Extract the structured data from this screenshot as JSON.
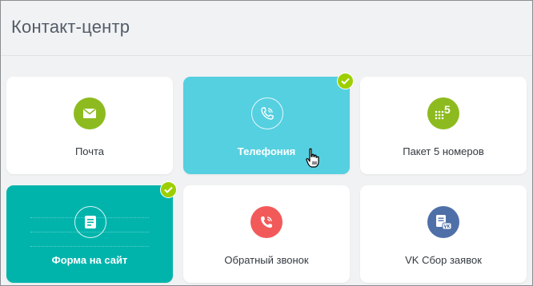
{
  "header": {
    "title": "Контакт-центр"
  },
  "tiles": [
    {
      "label": "Почта",
      "icon": "envelope-icon",
      "color": "#8dbb1f",
      "active": false,
      "checked": false
    },
    {
      "label": "Телефония",
      "icon": "phone-icon",
      "color": "#55d0e0",
      "active": true,
      "checked": true
    },
    {
      "label": "Пакет 5 номеров",
      "icon": "number-pack-icon",
      "badge": "5",
      "color": "#8dbb1f",
      "active": false,
      "checked": false
    },
    {
      "label": "Форма на сайт",
      "icon": "form-icon",
      "color": "#00b4ac",
      "active": true,
      "checked": true
    },
    {
      "label": "Обратный звонок",
      "icon": "callback-icon",
      "color": "#f25a5a",
      "active": false,
      "checked": false
    },
    {
      "label": "VK Сбор заявок",
      "icon": "vk-form-icon",
      "color": "#4f6fa8",
      "active": false,
      "checked": false
    }
  ],
  "colors": {
    "check_badge": "#9dcf00",
    "telephony_tile": "#55d0e0",
    "form_tile": "#00b4ac"
  }
}
